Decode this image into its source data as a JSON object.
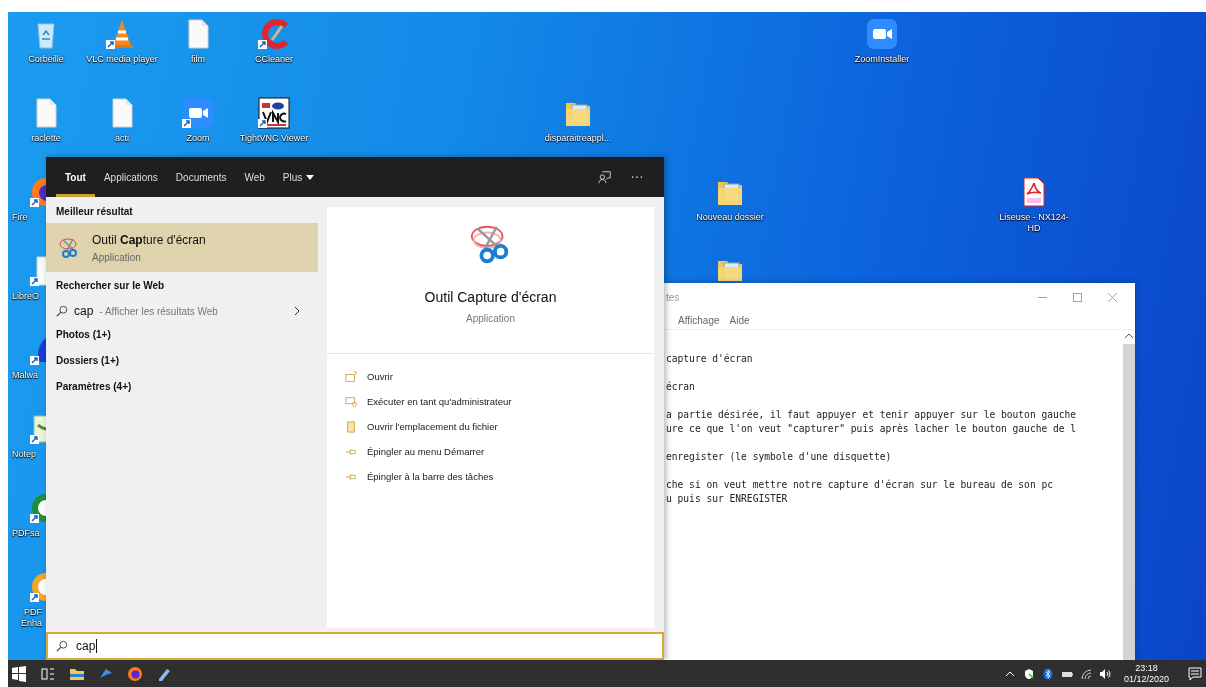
{
  "desktop": {
    "icons": [
      {
        "kind": "recycle-bin",
        "label": "Corbeille",
        "shortcut": false
      },
      {
        "kind": "cone",
        "label": "VLC media player",
        "shortcut": true
      },
      {
        "kind": "document",
        "label": "film",
        "shortcut": false
      },
      {
        "kind": "cleaner",
        "label": "CCleaner",
        "shortcut": true
      },
      {
        "kind": "camera",
        "label": "ZoomInstaller",
        "shortcut": false
      },
      {
        "kind": "document",
        "label": "raclette",
        "shortcut": false
      },
      {
        "kind": "document",
        "label": "acti",
        "shortcut": false
      },
      {
        "kind": "camera",
        "label": "Zoom",
        "shortcut": true
      },
      {
        "kind": "vnc",
        "label": "TightVNC Viewer",
        "shortcut": true
      },
      {
        "kind": "folder",
        "label": "disparaitreappl...",
        "shortcut": false
      },
      {
        "kind": "browser",
        "label": "Fire",
        "shortcut": true
      },
      {
        "kind": "folder",
        "label": "Nouveau dossier",
        "shortcut": false
      },
      {
        "kind": "pdf",
        "label": "Liseuse - NX124-HD",
        "shortcut": false
      },
      {
        "kind": "writer",
        "label": "LibreO",
        "shortcut": true
      },
      {
        "kind": "folder",
        "shortcut": false
      },
      {
        "kind": "shield-app",
        "label": "Malwa",
        "shortcut": true
      },
      {
        "kind": "notepad",
        "label": "Notep",
        "shortcut": true
      },
      {
        "kind": "ring-green",
        "label": "PDFsa",
        "shortcut": true
      },
      {
        "kind": "ring-orange",
        "label": "PDF Enha",
        "shortcut": true
      }
    ]
  },
  "notepad": {
    "title": "tes",
    "menu": [
      "Affichage",
      "Aide"
    ],
    "paragraphs": [
      [
        "capture d'écran"
      ],
      [
        "écran"
      ],
      [
        "a partie désirée, il faut appuyer et tenir appuyer sur le bouton gauche",
        "ure ce que l'on veut \"capturer\" puis après lacher le bouton gauche de l"
      ],
      [
        "enregister (le symbole d'une disquette)"
      ],
      [
        "che si on veut mettre notre capture d'écran sur le bureau de son pc",
        "u puis sur ENREGISTER"
      ]
    ]
  },
  "start_menu": {
    "tabs": [
      {
        "label": "Tout",
        "selected": true,
        "kind": "tab"
      },
      {
        "label": "Applications",
        "selected": false,
        "kind": "tab"
      },
      {
        "label": "Documents",
        "selected": false,
        "kind": "tab"
      },
      {
        "label": "Web",
        "selected": false,
        "kind": "tab"
      },
      {
        "label": "Plus",
        "selected": false,
        "kind": "dropdown"
      }
    ],
    "best_match": {
      "heading": "Meilleur résultat",
      "title": "Outil **Cap**ture d'écran",
      "subtitle": "Application",
      "selected": true
    },
    "web": {
      "heading": "Rechercher sur le Web",
      "query": "cap",
      "hint": "- Afficher les résultats Web"
    },
    "categories": [
      "Photos (1+)",
      "Dossiers (1+)",
      "Paramètres (4+)"
    ],
    "preview": {
      "title": "Outil Capture d'écran",
      "subtitle": "Application",
      "actions": [
        {
          "kind": "open",
          "label": "Ouvrir"
        },
        {
          "kind": "admin",
          "label": "Exécuter en tant qu'administrateur"
        },
        {
          "kind": "folder",
          "label": "Ouvrir l'emplacement du fichier"
        },
        {
          "kind": "pin",
          "label": "Épingler au menu Démarrer"
        },
        {
          "kind": "pin",
          "label": "Épingler à la barre des tâches"
        }
      ]
    },
    "search": {
      "value": "cap"
    }
  },
  "taskbar": {
    "time": "23:18",
    "date": "01/12/2020"
  }
}
